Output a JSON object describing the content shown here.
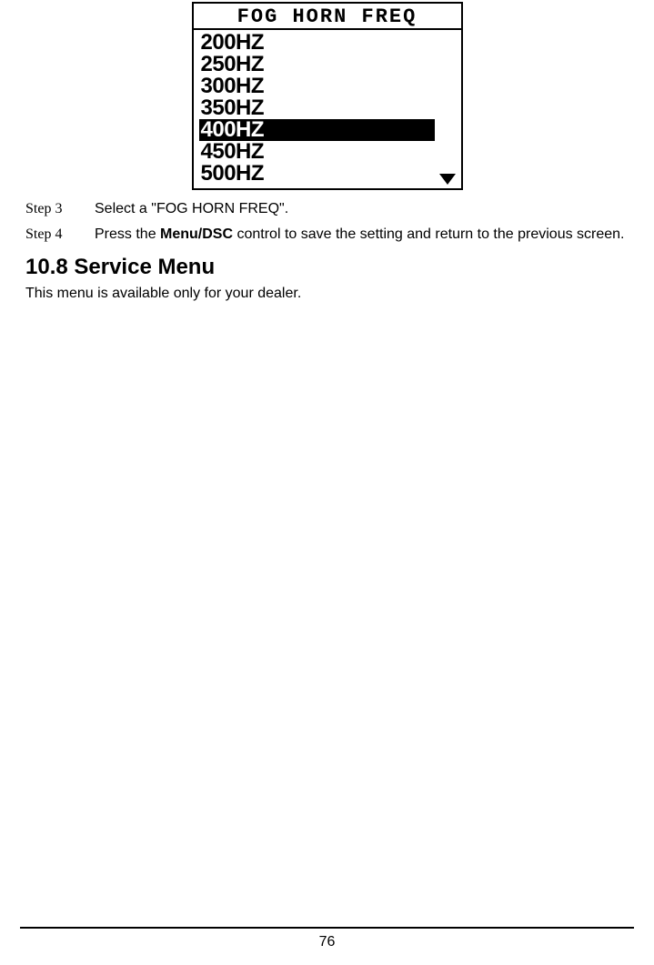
{
  "lcd": {
    "title": "FOG HORN FREQ",
    "items": [
      "200HZ",
      "250HZ",
      "300HZ",
      "350HZ",
      "400HZ",
      "450HZ",
      "500HZ"
    ],
    "selectedIndex": 4
  },
  "steps": [
    {
      "label": "Step 3",
      "pre": "Select a \"",
      "mid": "FOG HORN FREQ",
      "post": "\"."
    },
    {
      "label": "Step 4",
      "pre": "Press the ",
      "bold": "Menu/DSC",
      "post": " control to save the setting and return to the previous screen."
    }
  ],
  "section": {
    "heading": "10.8 Service Menu",
    "body": "This menu is available only for your dealer."
  },
  "pageNumber": "76"
}
